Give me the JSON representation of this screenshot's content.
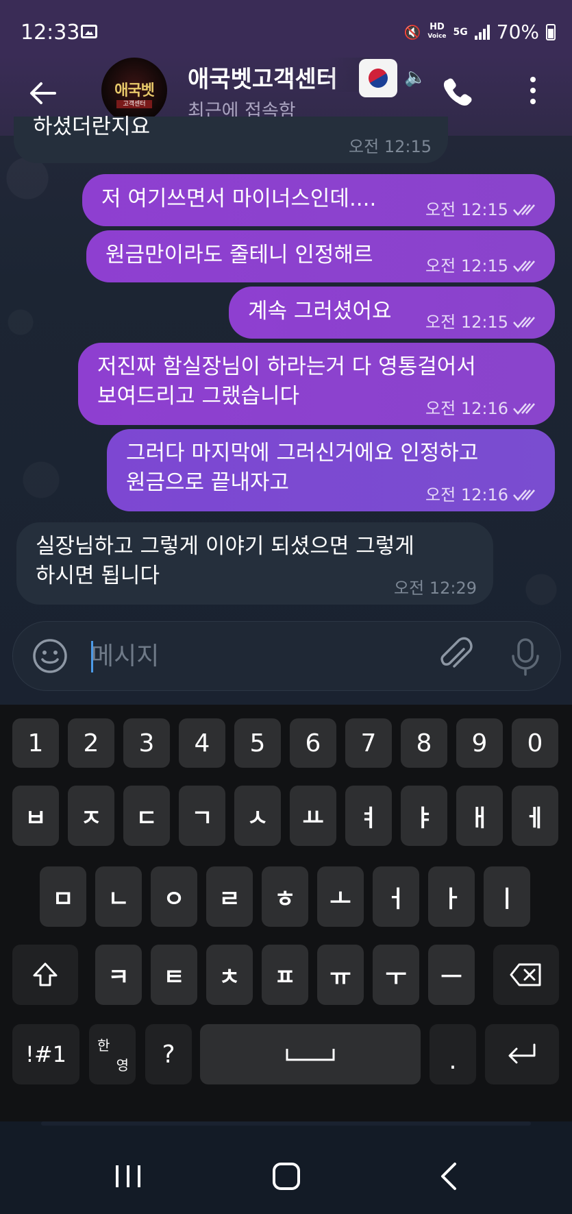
{
  "status_bar": {
    "time": "12:33",
    "battery": "70%",
    "hd_label": "HD",
    "hd_sub": "Voice",
    "network": "5G"
  },
  "header": {
    "title": "애국벳고객센터",
    "status": "최근에 접속함",
    "avatar_text": "애국벳",
    "avatar_sub": "고객센터"
  },
  "messages": [
    {
      "direction": "in",
      "lines": [
        "하셨더란지요"
      ],
      "time": "오전 12:15"
    },
    {
      "direction": "out",
      "lines": [
        "저 여기쓰면서 마이너스인데...."
      ],
      "time": "오전 12:15",
      "read": true
    },
    {
      "direction": "out",
      "lines": [
        "원금만이라도 줄테니 인정해르"
      ],
      "time": "오전 12:15",
      "read": true
    },
    {
      "direction": "out",
      "lines": [
        "계속 그러셨어요"
      ],
      "time": "오전 12:15",
      "read": true
    },
    {
      "direction": "out",
      "lines": [
        "저진짜 함실장님이 하라는거 다 영통걸어서",
        "보여드리고 그랬습니다"
      ],
      "time": "오전 12:16",
      "read": true
    },
    {
      "direction": "out",
      "lines": [
        "그러다 마지막에 그러신거에요 인정하고",
        "원금으로 끝내자고"
      ],
      "time": "오전 12:16",
      "read": true
    },
    {
      "direction": "in",
      "lines": [
        "실장님하고 그렇게 이야기 되셨으면 그렇게",
        "하시면 됩니다"
      ],
      "time": "오전 12:29"
    }
  ],
  "composer": {
    "placeholder": "메시지"
  },
  "keyboard": {
    "row_numbers": [
      "1",
      "2",
      "3",
      "4",
      "5",
      "6",
      "7",
      "8",
      "9",
      "0"
    ],
    "row_1": [
      "ㅂ",
      "ㅈ",
      "ㄷ",
      "ㄱ",
      "ㅅ",
      "ㅛ",
      "ㅕ",
      "ㅑ",
      "ㅐ",
      "ㅔ"
    ],
    "row_2": [
      "ㅁ",
      "ㄴ",
      "ㅇ",
      "ㄹ",
      "ㅎ",
      "ㅗ",
      "ㅓ",
      "ㅏ",
      "ㅣ"
    ],
    "row_3": [
      "ㅋ",
      "ㅌ",
      "ㅊ",
      "ㅍ",
      "ㅠ",
      "ㅜ",
      "ㅡ"
    ],
    "symbols_label": "!#1",
    "lang_top": "한",
    "lang_bottom": "영",
    "question": "?",
    "period": "."
  },
  "colors": {
    "outgoing_bubble": "#8e3fd0",
    "incoming_bubble": "#252f3c",
    "header": "#3a2c56",
    "keyboard": "#111214",
    "key": "#2e2f31"
  }
}
